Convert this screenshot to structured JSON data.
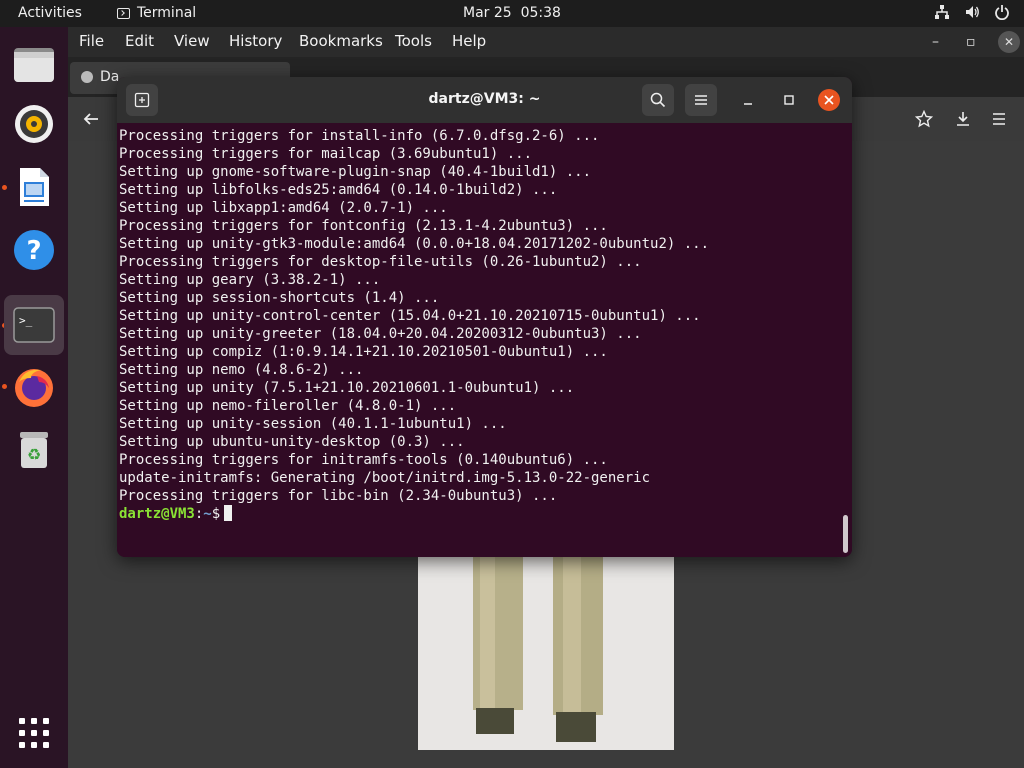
{
  "topbar": {
    "activities": "Activities",
    "app_name": "Terminal",
    "date": "Mar 25",
    "time": "05:38",
    "tray_icons": [
      "network-icon",
      "volume-icon",
      "power-icon"
    ]
  },
  "dock": {
    "items": [
      "files-icon",
      "rhythmbox-icon",
      "libreoffice-impress-icon",
      "help-icon",
      "terminal-icon",
      "firefox-icon",
      "trash-icon"
    ],
    "show_apps": "show-apps-icon"
  },
  "browser": {
    "menu": [
      "File",
      "Edit",
      "View",
      "History",
      "Bookmarks",
      "Tools",
      "Help"
    ],
    "tab_title": "Da",
    "window_controls": [
      "–",
      "▫",
      "✕"
    ]
  },
  "terminal": {
    "title": "dartz@VM3: ~",
    "lines": [
      "Processing triggers for install-info (6.7.0.dfsg.2-6) ...",
      "Processing triggers for mailcap (3.69ubuntu1) ...",
      "Setting up gnome-software-plugin-snap (40.4-1build1) ...",
      "Setting up libfolks-eds25:amd64 (0.14.0-1build2) ...",
      "Setting up libxapp1:amd64 (2.0.7-1) ...",
      "Processing triggers for fontconfig (2.13.1-4.2ubuntu3) ...",
      "Setting up unity-gtk3-module:amd64 (0.0.0+18.04.20171202-0ubuntu2) ...",
      "Processing triggers for desktop-file-utils (0.26-1ubuntu2) ...",
      "Setting up geary (3.38.2-1) ...",
      "Setting up session-shortcuts (1.4) ...",
      "Setting up unity-control-center (15.04.0+21.10.20210715-0ubuntu1) ...",
      "Setting up unity-greeter (18.04.0+20.04.20200312-0ubuntu3) ...",
      "Setting up compiz (1:0.9.14.1+21.10.20210501-0ubuntu1) ...",
      "Setting up nemo (4.8.6-2) ...",
      "Setting up unity (7.5.1+21.10.20210601.1-0ubuntu1) ...",
      "Setting up nemo-fileroller (4.8.0-1) ...",
      "Setting up unity-session (40.1.1-1ubuntu1) ...",
      "Setting up ubuntu-unity-desktop (0.3) ...",
      "Processing triggers for initramfs-tools (0.140ubuntu6) ...",
      "update-initramfs: Generating /boot/initrd.img-5.13.0-22-generic",
      "Processing triggers for libc-bin (2.34-0ubuntu3) ..."
    ],
    "prompt_user": "dartz@VM3",
    "prompt_sep": ":",
    "prompt_path": "~",
    "prompt_symbol": "$"
  },
  "colors": {
    "terminal_bg": "#300a24",
    "prompt_user": "#8ae234",
    "prompt_path": "#729fcf",
    "close_button": "#e95420"
  }
}
